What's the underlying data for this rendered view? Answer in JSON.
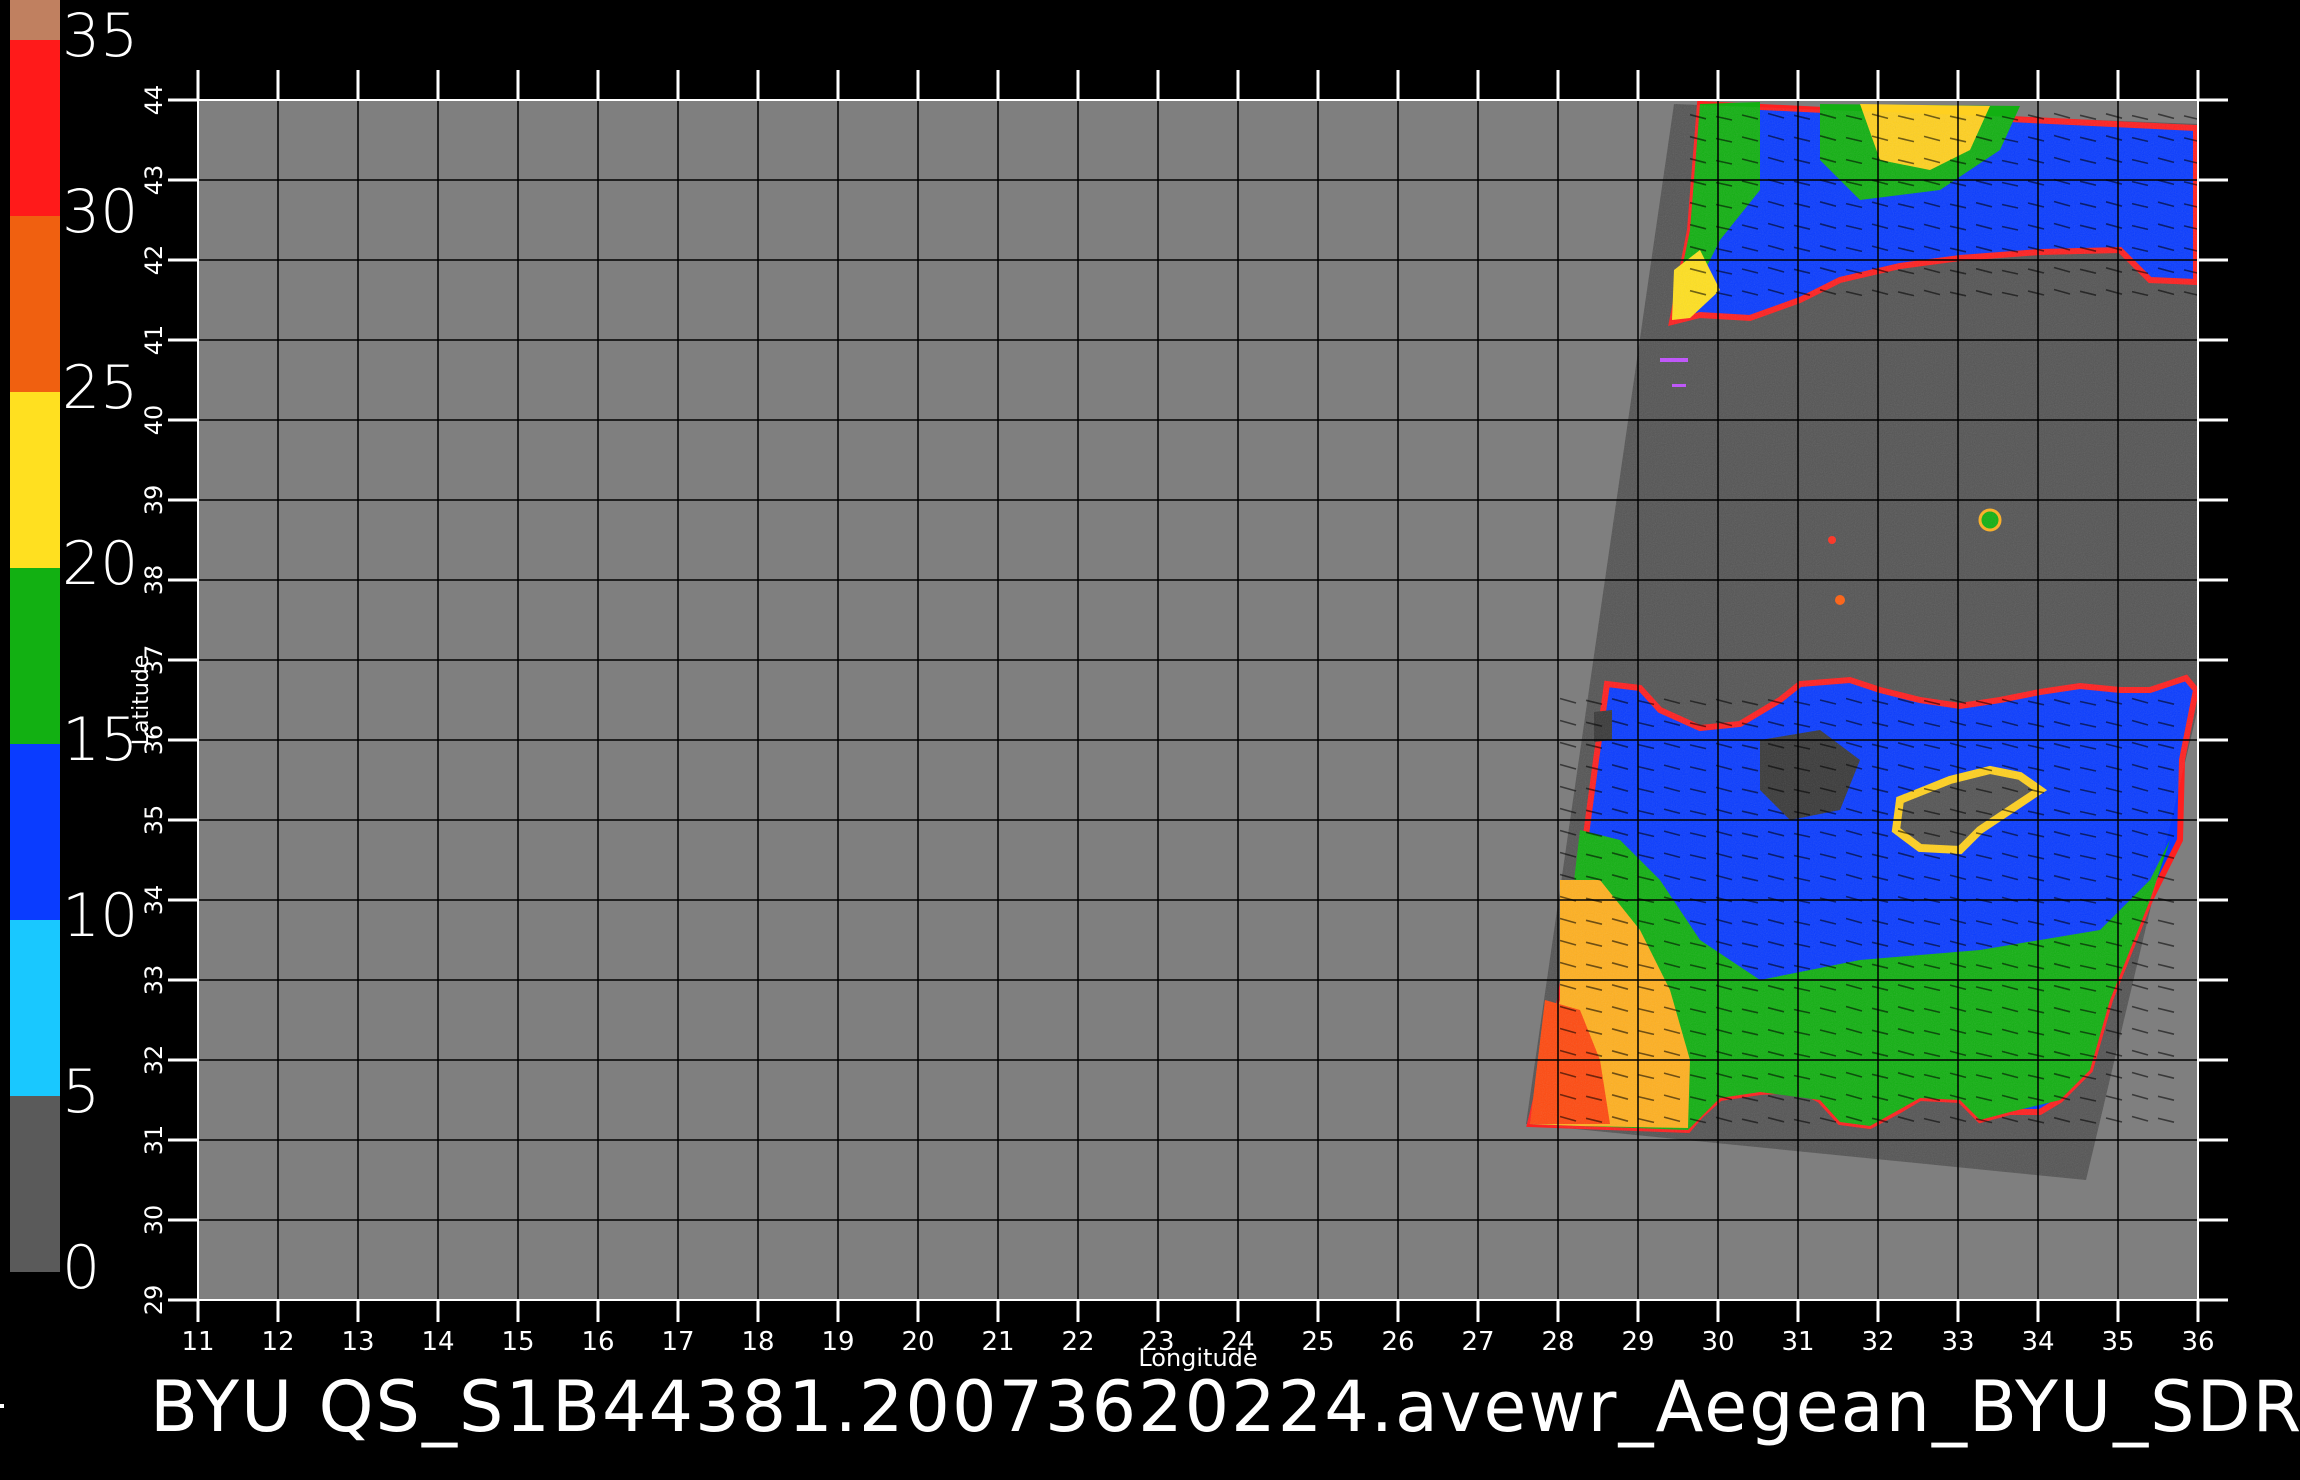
{
  "colorbar": {
    "labels": [
      "35",
      "30",
      "25",
      "20",
      "15",
      "10",
      "5",
      "0"
    ],
    "segments": [
      {
        "from": 0,
        "to": 5,
        "color": "#5a5a5a"
      },
      {
        "from": 5,
        "to": 10,
        "color": "#19c8ff"
      },
      {
        "from": 10,
        "to": 15,
        "color": "#0a3cff"
      },
      {
        "from": 15,
        "to": 20,
        "color": "#12b012"
      },
      {
        "from": 20,
        "to": 25,
        "color": "#ffe020"
      },
      {
        "from": 25,
        "to": 30,
        "color": "#f06010"
      },
      {
        "from": 30,
        "to": 35,
        "color": "#ff1a1a"
      },
      {
        "from": 35,
        "to": 36,
        "color": "#c08060"
      }
    ]
  },
  "map": {
    "x_axis_label": "Longitude",
    "y_axis_label": "Latitude",
    "x_ticks": [
      "11",
      "12",
      "13",
      "14",
      "15",
      "16",
      "17",
      "18",
      "19",
      "20",
      "21",
      "22",
      "23",
      "24",
      "25",
      "26",
      "27",
      "28",
      "29",
      "30",
      "31",
      "32",
      "33",
      "34",
      "35",
      "36"
    ],
    "y_ticks": [
      "29",
      "30",
      "31",
      "32",
      "33",
      "34",
      "35",
      "36",
      "37",
      "38",
      "39",
      "40",
      "41",
      "42",
      "43",
      "44"
    ],
    "lon_range": [
      11,
      36
    ],
    "lat_range": [
      29,
      44
    ],
    "background_color": "#7f7f7f",
    "land_color": "#555555",
    "swath_corners": [
      [
        29.45,
        43.95
      ],
      [
        36.0,
        43.7
      ],
      [
        36.0,
        36.4
      ],
      [
        34.6,
        30.5
      ],
      [
        27.6,
        31.2
      ]
    ]
  },
  "footer": {
    "title": "BYU  QS_S1B44381.20073620224.avewr_Aegean_BYU_SDR"
  }
}
